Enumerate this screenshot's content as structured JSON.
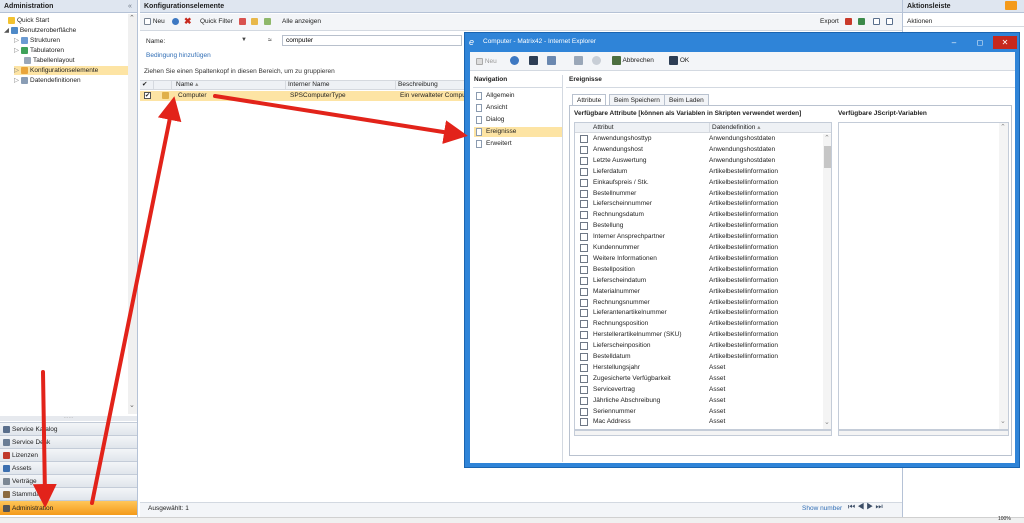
{
  "left_panel": {
    "title": "Administration",
    "tree": [
      {
        "label": "Quick Start"
      },
      {
        "label": "Benutzeroberfläche"
      },
      {
        "label": "Strukturen"
      },
      {
        "label": "Tabulatoren"
      },
      {
        "label": "Tabellenlayout"
      },
      {
        "label": "Konfigurationselemente"
      },
      {
        "label": "Datendefinitionen"
      }
    ],
    "accordion": [
      {
        "label": "Service Katalog"
      },
      {
        "label": "Service Desk"
      },
      {
        "label": "Lizenzen"
      },
      {
        "label": "Assets"
      },
      {
        "label": "Verträge"
      },
      {
        "label": "Stammdaten"
      },
      {
        "label": "Administration"
      }
    ]
  },
  "center": {
    "title": "Konfigurationselemente",
    "toolbar": {
      "new": "Neu",
      "quick_filter": "Quick Filter",
      "show_all": "Alle anzeigen",
      "export": "Export"
    },
    "filter": {
      "field_label": "Name:",
      "operator": "≈",
      "value": "computer",
      "add_condition": "Bedingung hinzufügen"
    },
    "group_hint": "Ziehen Sie einen Spaltenkopf in diesen Bereich, um zu gruppieren",
    "columns": [
      "Name",
      "Interner Name",
      "Beschreibung"
    ],
    "rows": [
      {
        "name": "Computer",
        "internal": "SPSComputerType",
        "desc": "Ein verwalteter Compu"
      }
    ],
    "status": "Ausgewählt: 1",
    "show_number": "Show number"
  },
  "right_panel": {
    "title": "Aktionsleiste",
    "subtitle": "Aktionen"
  },
  "dialog": {
    "title": "Computer - Matrix42 - Internet Explorer",
    "toolbar": {
      "new": "Neu",
      "cancel": "Abbrechen",
      "ok": "OK"
    },
    "nav_title": "Navigation",
    "nav_items": [
      {
        "label": "Allgemein"
      },
      {
        "label": "Ansicht"
      },
      {
        "label": "Dialog"
      },
      {
        "label": "Ereignisse"
      },
      {
        "label": "Erweitert"
      }
    ],
    "section_title": "Ereignisse",
    "tabs": [
      {
        "label": "Attribute"
      },
      {
        "label": "Beim Speichern"
      },
      {
        "label": "Beim Laden"
      }
    ],
    "attributes_title": "Verfügbare Attribute [können als Variablen in Skripten verwendet werden]",
    "js_title": "Verfügbare JScript-Variablen",
    "attr_columns": [
      "Attribut",
      "Datendefinition"
    ],
    "attributes": [
      {
        "name": "Anwendungshosttyp",
        "def": "Anwendungshostdaten"
      },
      {
        "name": "Anwendungshost",
        "def": "Anwendungshostdaten"
      },
      {
        "name": "Letzte Auswertung",
        "def": "Anwendungshostdaten"
      },
      {
        "name": "Lieferdatum",
        "def": "Artikelbestellinformation"
      },
      {
        "name": "Einkaufspreis / Stk.",
        "def": "Artikelbestellinformation"
      },
      {
        "name": "Bestellnummer",
        "def": "Artikelbestellinformation"
      },
      {
        "name": "Lieferscheinnummer",
        "def": "Artikelbestellinformation"
      },
      {
        "name": "Rechnungsdatum",
        "def": "Artikelbestellinformation"
      },
      {
        "name": "Bestellung",
        "def": "Artikelbestellinformation"
      },
      {
        "name": "Interner Ansprechpartner",
        "def": "Artikelbestellinformation"
      },
      {
        "name": "Kundennummer",
        "def": "Artikelbestellinformation"
      },
      {
        "name": "Weitere Informationen",
        "def": "Artikelbestellinformation"
      },
      {
        "name": "Bestellposition",
        "def": "Artikelbestellinformation"
      },
      {
        "name": "Lieferscheindatum",
        "def": "Artikelbestellinformation"
      },
      {
        "name": "Materialnummer",
        "def": "Artikelbestellinformation"
      },
      {
        "name": "Rechnungsnummer",
        "def": "Artikelbestellinformation"
      },
      {
        "name": "Lieferantenartikelnummer",
        "def": "Artikelbestellinformation"
      },
      {
        "name": "Rechnungsposition",
        "def": "Artikelbestellinformation"
      },
      {
        "name": "Herstellerartikelnummer (SKU)",
        "def": "Artikelbestellinformation"
      },
      {
        "name": "Lieferscheinposition",
        "def": "Artikelbestellinformation"
      },
      {
        "name": "Bestelldatum",
        "def": "Artikelbestellinformation"
      },
      {
        "name": "Herstellungsjahr",
        "def": "Asset"
      },
      {
        "name": "Zugesicherte Verfügbarkeit",
        "def": "Asset"
      },
      {
        "name": "Servicevertrag",
        "def": "Asset"
      },
      {
        "name": "Jährliche Abschreibung",
        "def": "Asset"
      },
      {
        "name": "Seriennummer",
        "def": "Asset"
      },
      {
        "name": "Mac Address",
        "def": "Asset"
      }
    ]
  },
  "statusbar": {
    "zoom": "100%"
  },
  "colors": {
    "accent": "#f49a1a",
    "arrow": "#e2231a",
    "dialog_frame": "#2f84d8",
    "selection": "#fde4a4"
  }
}
